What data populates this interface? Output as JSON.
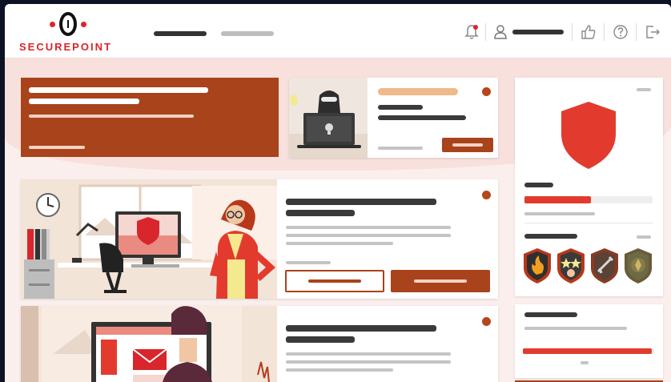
{
  "brand": {
    "name": "SECUREPOINT",
    "accent": "#d8262c",
    "dark": "#111111"
  },
  "topbar": {
    "nav": [
      {
        "name": "nav-item-1",
        "color": "#333333"
      },
      {
        "name": "nav-item-2",
        "color": "#b8b8b8"
      }
    ],
    "icons": [
      "bell-icon",
      "user-icon",
      "thumbs-up-icon",
      "help-icon",
      "logout-icon"
    ]
  },
  "colors": {
    "primary": "#a8431b",
    "card_dark": "#a8431b",
    "badge_light": "#f0b98a",
    "shield": "#d8262c",
    "progress": "#e23b2e"
  },
  "widgets": {
    "progress_primary": 0.52,
    "progress_secondary": 0.98,
    "badges": [
      "fire-badge-icon",
      "stars-badge-icon",
      "sword-badge-icon",
      "shield-badge-icon"
    ]
  }
}
